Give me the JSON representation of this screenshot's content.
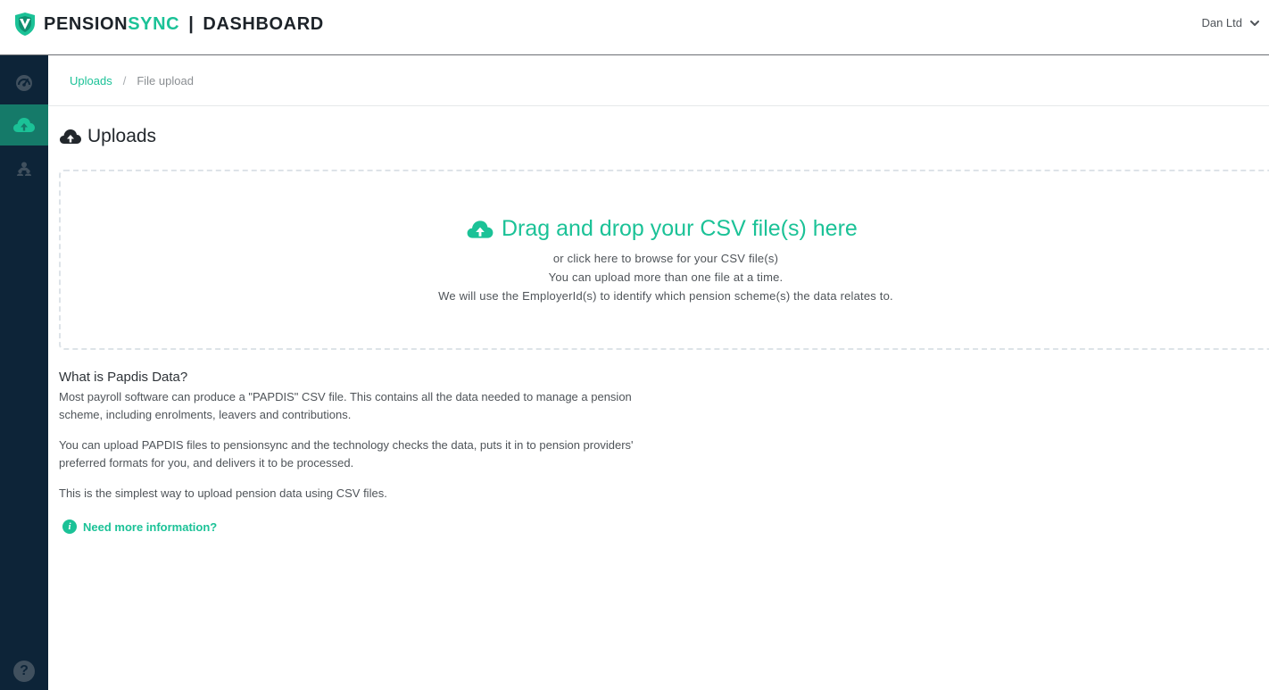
{
  "header": {
    "brand_part1": "PENSION",
    "brand_part2": "SYNC",
    "separator": "|",
    "section": "DASHBOARD",
    "account": "Dan Ltd"
  },
  "sidebar": {
    "items": [
      {
        "icon": "speedometer-icon",
        "active": false
      },
      {
        "icon": "cloud-upload-icon",
        "active": true
      },
      {
        "icon": "users-icon",
        "active": false
      }
    ],
    "help_label": "?"
  },
  "breadcrumb": {
    "link": "Uploads",
    "separator": "/",
    "current": "File upload"
  },
  "page": {
    "title": "Uploads"
  },
  "dropzone": {
    "heading": "Drag and drop your CSV file(s) here",
    "line1": "or click here to browse for your CSV file(s)",
    "line2": "You can upload more than one file at a time.",
    "line3": "We will use the EmployerId(s) to identify which pension scheme(s) the data relates to."
  },
  "info": {
    "heading": "What is Papdis Data?",
    "para1": "Most payroll software can produce a \"PAPDIS\" CSV file. This contains all the data needed to manage a pension scheme, including enrolments, leavers and contributions.",
    "para2": "You can upload PAPDIS files to pensionsync and the technology checks the data, puts it in to pension providers' preferred formats for you, and delivers it to be processed.",
    "para3": "This is the simplest way to upload pension data using CSV files.",
    "more_link": "Need more information?"
  },
  "colors": {
    "accent": "#1bc297",
    "sidebar_bg": "#0d2438",
    "sidebar_active": "#157a69"
  }
}
